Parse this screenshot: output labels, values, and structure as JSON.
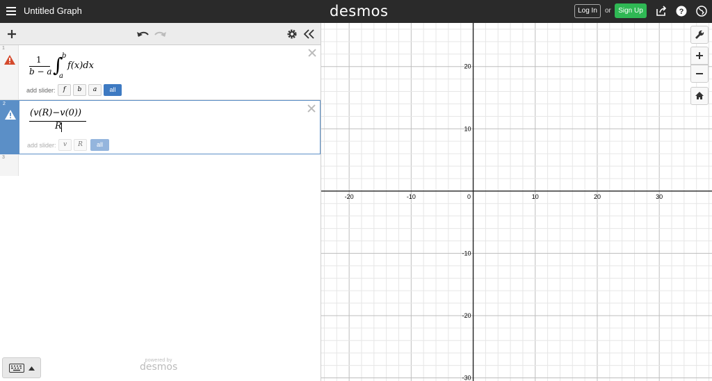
{
  "header": {
    "title": "Untitled Graph",
    "logo": "desmos",
    "login_label": "Log In",
    "or_label": "or",
    "signup_label": "Sign Up",
    "icons": [
      "menu-icon",
      "share-icon",
      "help-icon",
      "language-icon"
    ]
  },
  "toolbar": {
    "icons": [
      "add-icon",
      "undo-icon",
      "redo-icon",
      "settings-icon",
      "collapse-icon"
    ]
  },
  "expressions": [
    {
      "number": "1",
      "status": "warning",
      "latex": "\\frac{1}{b-a}\\int_{a}^{b} f(x) dx",
      "parts": {
        "numerator": "1",
        "denominator": "b − a",
        "lower": "a",
        "upper": "b",
        "body": "f(x)dx"
      },
      "slider_label": "add slider:",
      "slider_vars": [
        "f",
        "b",
        "a"
      ],
      "slider_all": "all"
    },
    {
      "number": "2",
      "status": "warning",
      "selected": true,
      "latex": "\\frac{(v(R)-v(0))}{R}",
      "parts": {
        "numerator": "(v(R)−v(0))",
        "denominator": "R"
      },
      "slider_label": "add slider:",
      "slider_vars": [
        "v",
        "R"
      ],
      "slider_all": "all"
    },
    {
      "number": "3"
    }
  ],
  "footer": {
    "powered_by": "powered by",
    "brand": "desmos"
  },
  "graph": {
    "x_ticks": [
      "-20",
      "-10",
      "0",
      "10",
      "20",
      "30"
    ],
    "y_ticks": [
      "20",
      "10",
      "-10",
      "-20",
      "-30"
    ],
    "x_range": [
      -24.5,
      38.5
    ],
    "y_range": [
      -30.5,
      27
    ],
    "tools": [
      "wrench-icon",
      "zoom-in-icon",
      "zoom-out-icon",
      "home-icon"
    ]
  },
  "colors": {
    "topbar": "#2a2a2a",
    "signup": "#2fb854",
    "selected": "#5b8fc7",
    "warning": "#d44a2d"
  }
}
